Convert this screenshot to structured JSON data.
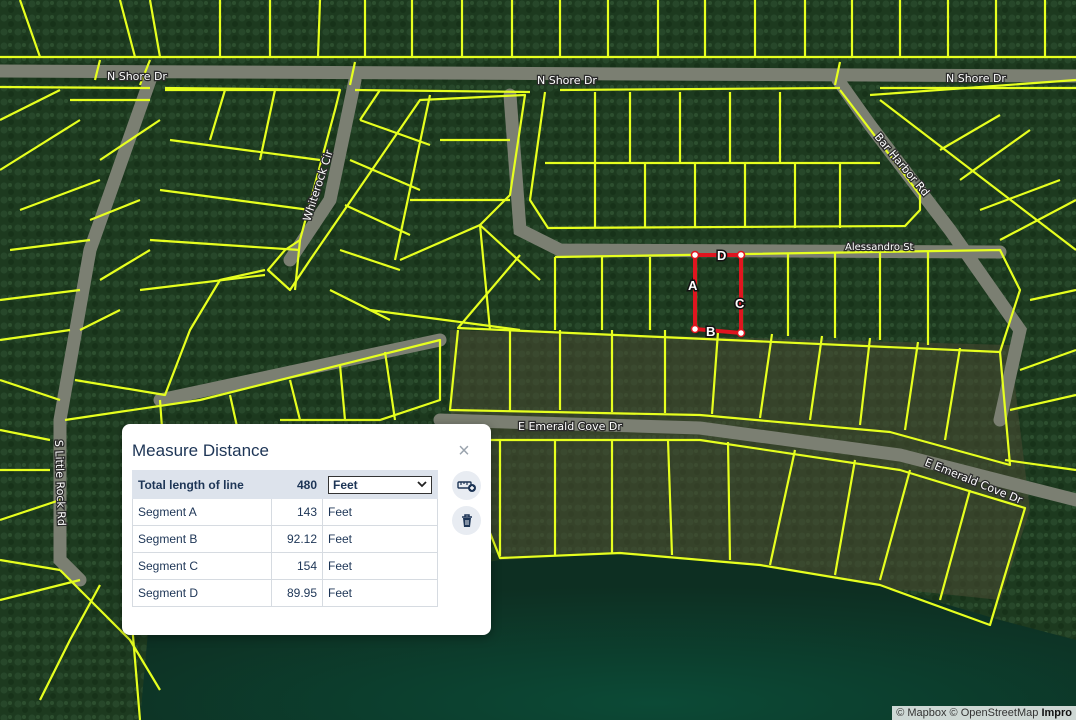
{
  "map": {
    "roads": {
      "n_shore_1": "N Shore Dr",
      "n_shore_2": "N Shore Dr",
      "n_shore_3": "N Shore Dr",
      "whiterock": "Whiterock Cir",
      "bar_harbor": "Bar Harbor Rd",
      "alessandro": "Alessandro St",
      "e_emerald_1": "E Emerald Cove Dr",
      "e_emerald_2": "E Emerald Cove Dr",
      "s_little_rock": "S Little Rock Rd"
    },
    "segment_labels": {
      "a": "A",
      "b": "B",
      "c": "C",
      "d": "D"
    },
    "colors": {
      "parcel": "#e6ff1f",
      "measure": "#e0151f",
      "vegetation": "#1e3a20",
      "water": "#0f3a2a"
    }
  },
  "panel": {
    "title": "Measure Distance",
    "close_icon": "close-icon",
    "total": {
      "label": "Total length of line",
      "value": "480",
      "unit": "Feet"
    },
    "segments": [
      {
        "label": "Segment A",
        "value": "143",
        "unit": "Feet"
      },
      {
        "label": "Segment B",
        "value": "92.12",
        "unit": "Feet"
      },
      {
        "label": "Segment C",
        "value": "154",
        "unit": "Feet"
      },
      {
        "label": "Segment D",
        "value": "89.95",
        "unit": "Feet"
      }
    ],
    "add_icon": "add-measurement-icon",
    "delete_icon": "trash-icon"
  },
  "attribution": {
    "mapbox": "© Mapbox",
    "osm": "© OpenStreetMap",
    "improve": "Impro"
  }
}
